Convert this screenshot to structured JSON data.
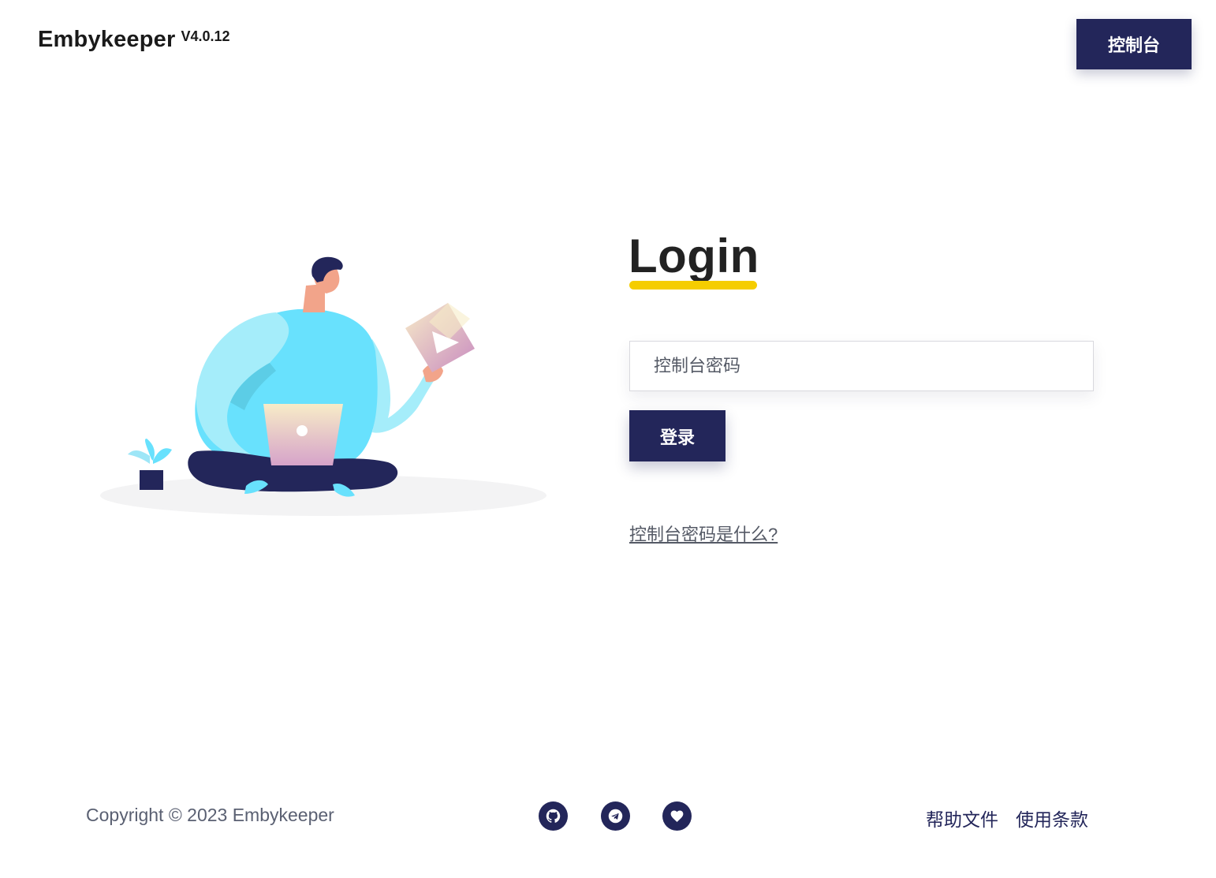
{
  "header": {
    "brand_name": "Embykeeper",
    "version": "V4.0.12",
    "console_button": "控制台"
  },
  "login": {
    "title": "Login",
    "password_placeholder": "控制台密码",
    "submit_label": "登录",
    "help_link": "控制台密码是什么?"
  },
  "footer": {
    "copyright": "Copyright © 2023 Embykeeper",
    "social": [
      {
        "icon": "github-icon"
      },
      {
        "icon": "telegram-icon"
      },
      {
        "icon": "heart-icon"
      }
    ],
    "links": [
      "帮助文件",
      "使用条款"
    ]
  },
  "colors": {
    "primary": "#23265a",
    "accent": "#f5cd00",
    "shirt": "#68e1fd",
    "text_muted": "#5a6072"
  }
}
